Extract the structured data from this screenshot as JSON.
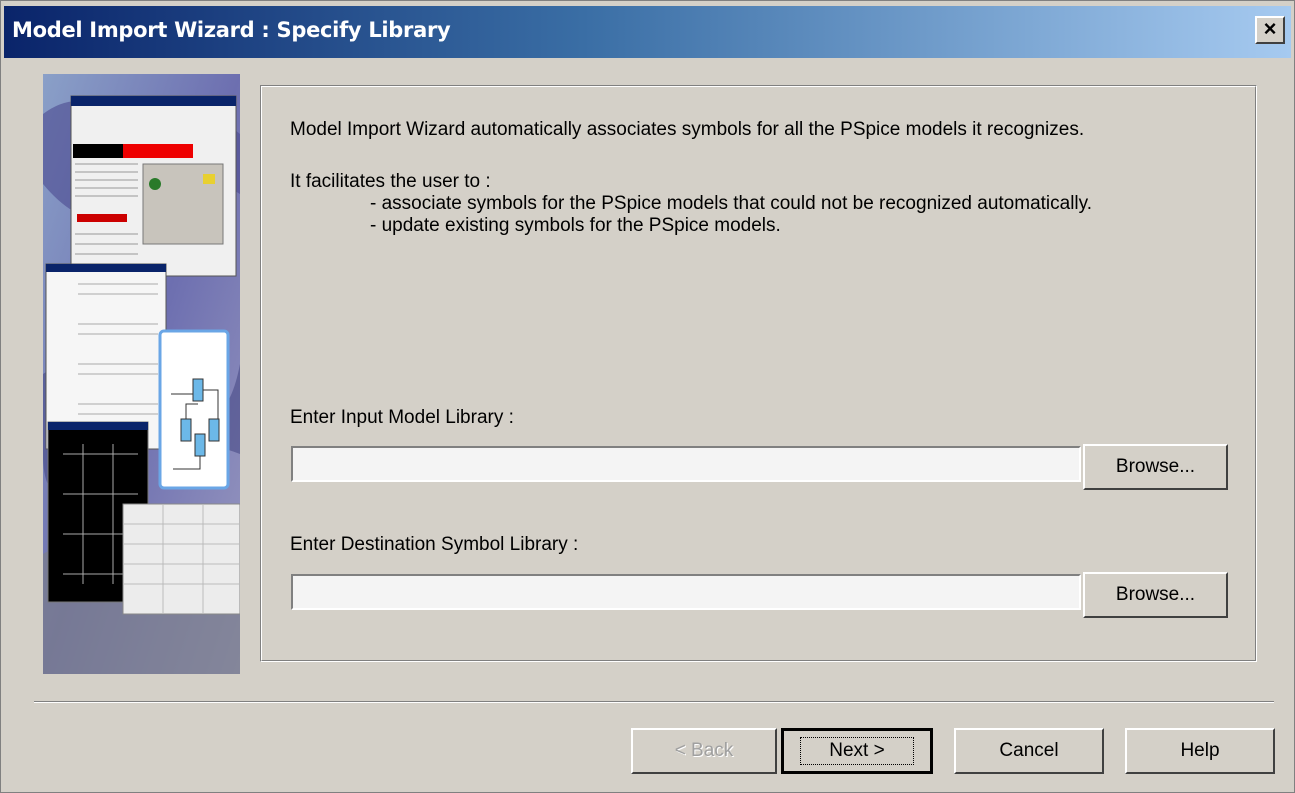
{
  "window": {
    "title": "Model Import Wizard : Specify Library",
    "close_label": "×"
  },
  "content": {
    "intro": "Model Import Wizard automatically associates symbols for all the PSpice models it recognizes.",
    "facilitates": "It facilitates the user to :",
    "bullets": [
      "- associate symbols for the PSpice models that could not be recognized automatically.",
      "- update existing symbols for the PSpice models."
    ],
    "input_model_label": "Enter Input Model Library :",
    "input_model_value": "",
    "destination_label": "Enter Destination Symbol Library :",
    "destination_value": "",
    "browse_label": "Browse..."
  },
  "footer": {
    "back_label": "< Back",
    "next_label": "Next >",
    "cancel_label": "Cancel",
    "help_label": "Help"
  },
  "colors": {
    "title_start": "#0a246a",
    "title_end": "#a6caf0",
    "face": "#d4d0c8"
  }
}
